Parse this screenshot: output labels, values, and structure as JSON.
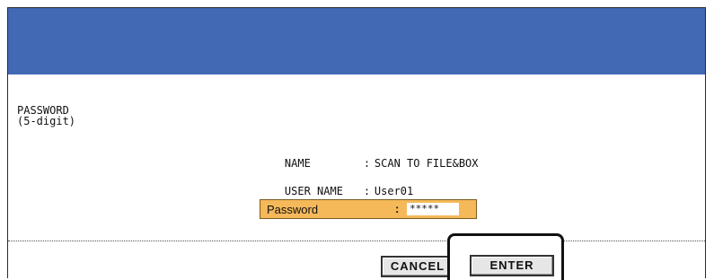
{
  "password_section": {
    "label": "PASSWORD\n(5-digit)"
  },
  "info": {
    "name_key": "NAME",
    "name_sep": ":",
    "name_value": "SCAN TO FILE&BOX",
    "user_key": "USER NAME",
    "user_sep": ":",
    "user_value": "User01"
  },
  "password_field": {
    "label": "Password",
    "colon": ":",
    "value": "*****"
  },
  "buttons": {
    "cancel": "CANCEL",
    "enter": "ENTER"
  },
  "colors": {
    "header": "#4169b4",
    "field": "#f5b95a"
  }
}
